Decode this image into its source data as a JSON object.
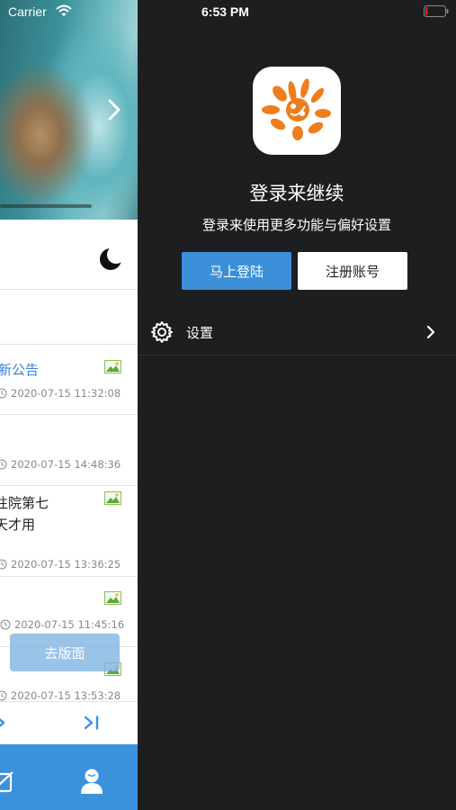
{
  "status_bar": {
    "carrier": "Carrier",
    "time": "6:53 PM"
  },
  "background_page": {
    "news": [
      {
        "title": "新公告",
        "time": "2020-07-15 11:32:08",
        "title_color": "#3b83d6"
      },
      {
        "title": "",
        "time": "2020-07-15 14:48:36"
      },
      {
        "title_line1": "往院第七",
        "title_line2": "天才用",
        "time": "2020-07-15 13:36:25"
      },
      {
        "title": "",
        "time": "2020-07-15 11:45:16"
      },
      {
        "title": "",
        "time": "2020-07-15 13:53:28"
      }
    ],
    "goto_button": "去版面",
    "icons": [
      "chevron-right-icon",
      "moon-icon",
      "clock-icon",
      "image-icon",
      "next-page-icon",
      "last-page-icon",
      "edit-icon",
      "user-icon"
    ],
    "tabbar_color": "#3a92dc"
  },
  "drawer": {
    "title": "登录来继续",
    "subtitle": "登录来使用更多功能与偏好设置",
    "login_button": "马上登陆",
    "register_button": "注册账号",
    "settings_label": "设置",
    "colors": {
      "background": "#1d1e20",
      "login_button": "#3a8fd8",
      "logo_orange": "#ee7d1c"
    }
  }
}
